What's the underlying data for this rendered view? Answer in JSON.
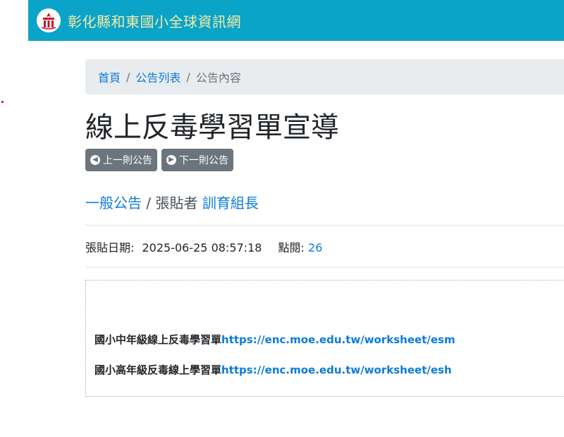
{
  "header": {
    "logo_icon": "school-emblem-icon",
    "site_title": "彰化縣和東國小全球資訊網",
    "background_color": "#0aa4c8",
    "title_color": "#f7e9a6"
  },
  "breadcrumb": {
    "items": [
      "首頁",
      "公告列表"
    ],
    "current": "公告內容",
    "separator": "/"
  },
  "post": {
    "title": "線上反毒學習單宣導",
    "prev_button": "上一則公告",
    "next_button": "下一則公告",
    "category": "一般公告",
    "poster_label": "/ 張貼者",
    "poster": "訓育組長",
    "date_label": "張貼日期:",
    "date": "2025-06-25 08:57:18",
    "views_label": "點閱:",
    "views": "26"
  },
  "content": {
    "lines": [
      {
        "text": "國小中年級線上反毒學習單",
        "url": "https://enc.moe.edu.tw/worksheet/esm"
      },
      {
        "text": "國小高年級反毒線上學習單",
        "url": "https://enc.moe.edu.tw/worksheet/esh"
      }
    ]
  },
  "colors": {
    "link": "#0d7bd9",
    "button": "#6c757d",
    "breadcrumb_bg": "#e9ecef"
  }
}
